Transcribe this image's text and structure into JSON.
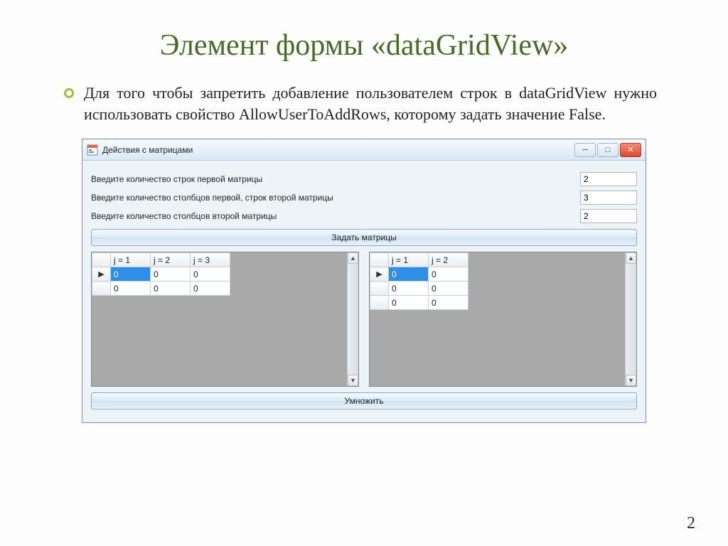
{
  "slide": {
    "title": "Элемент формы «dataGridView»",
    "bullet": "Для того чтобы запретить добавление пользователем строк в dataGridView нужно использовать свойство AllowUserToAddRows, которому задать значение False.",
    "page_number": "2"
  },
  "window": {
    "title": "Действия с матрицами",
    "rows_label_1": "Введите количество строк первой матрицы",
    "rows_value_1": "2",
    "rows_label_2": "Введите количество столбцов первой, строк второй матрицы",
    "rows_value_2": "3",
    "rows_label_3": "Введите количество столбцов второй матрицы",
    "rows_value_3": "2",
    "set_button": "Задать матрицы",
    "multiply_button": "Умножить"
  },
  "grid1": {
    "headers": [
      "j = 1",
      "j = 2",
      "j = 3"
    ],
    "rows": [
      {
        "marker": "▶",
        "cells": [
          "0",
          "0",
          "0"
        ],
        "selected": 0
      },
      {
        "marker": "",
        "cells": [
          "0",
          "0",
          "0"
        ],
        "selected": -1
      }
    ]
  },
  "grid2": {
    "headers": [
      "j = 1",
      "j = 2"
    ],
    "rows": [
      {
        "marker": "▶",
        "cells": [
          "0",
          "0"
        ],
        "selected": 0
      },
      {
        "marker": "",
        "cells": [
          "0",
          "0"
        ],
        "selected": -1
      },
      {
        "marker": "",
        "cells": [
          "0",
          "0"
        ],
        "selected": -1
      }
    ]
  }
}
